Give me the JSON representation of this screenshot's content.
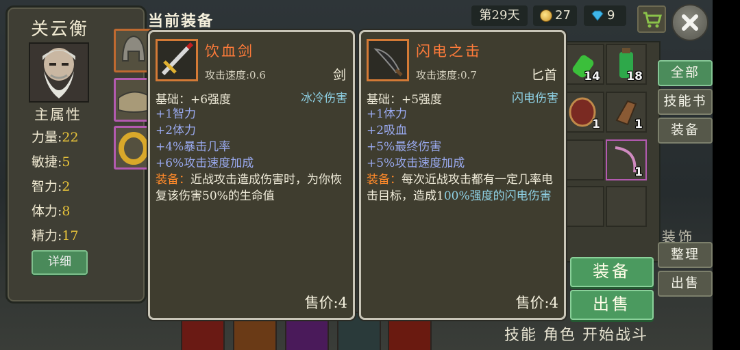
{
  "character": {
    "name": "关云衡",
    "attributes_title": "主属性",
    "attributes": [
      {
        "label": "力量:",
        "value": "22"
      },
      {
        "label": "敏捷:",
        "value": "5"
      },
      {
        "label": "智力:",
        "value": "2"
      },
      {
        "label": "体力:",
        "value": "8"
      },
      {
        "label": "精力:",
        "value": "17"
      }
    ],
    "detail_button": "详细"
  },
  "equipment_panel": {
    "title": "当前装备"
  },
  "topbar": {
    "day": "第29天",
    "coins": "27",
    "gems": "9"
  },
  "tabs": [
    "全部",
    "技能书",
    "装备"
  ],
  "inventory": {
    "counts": [
      "14",
      "18",
      "1",
      "1",
      "1"
    ]
  },
  "decor_label": "装饰",
  "actions": {
    "equip": "装备",
    "sell": "出售",
    "sort": "整理",
    "sell_small": "出售"
  },
  "bottom_bar_text": "技能 角色 开始战斗",
  "cards": [
    {
      "name": "饮血剑",
      "speed": "攻击速度:0.6",
      "weapon_type": "剑",
      "base": "基础：+6强度",
      "damage_type": "冰冷伤害",
      "stats": [
        "+1智力",
        "+2体力",
        "+4%暴击几率",
        "+6%攻击速度加成"
      ],
      "effect_label": "装备：",
      "effect_text": "近战攻击造成伤害时，为你恢复该伤害50%的生命值",
      "effect_highlight": "",
      "price": "售价:4"
    },
    {
      "name": "闪电之击",
      "speed": "攻击速度:0.7",
      "weapon_type": "匕首",
      "base": "基础：+5强度",
      "damage_type": "闪电伤害",
      "stats": [
        "+1体力",
        "+2吸血",
        "+5%最终伤害",
        "+5%攻击速度加成"
      ],
      "effect_label": "装备：",
      "effect_text": "每次近战攻击都有一定几率电击目标，造成1",
      "effect_highlight": "00%强度的闪电伤害",
      "price": "售价:4"
    }
  ],
  "colors": {
    "panel": "#3f3e34",
    "accent_green": "#4b9a5f",
    "item_name": "#ff7b3a",
    "stat_blue": "#9aaaf0",
    "damage_cyan": "#8fd2e6",
    "highlight_yellow": "#e7c33a"
  }
}
